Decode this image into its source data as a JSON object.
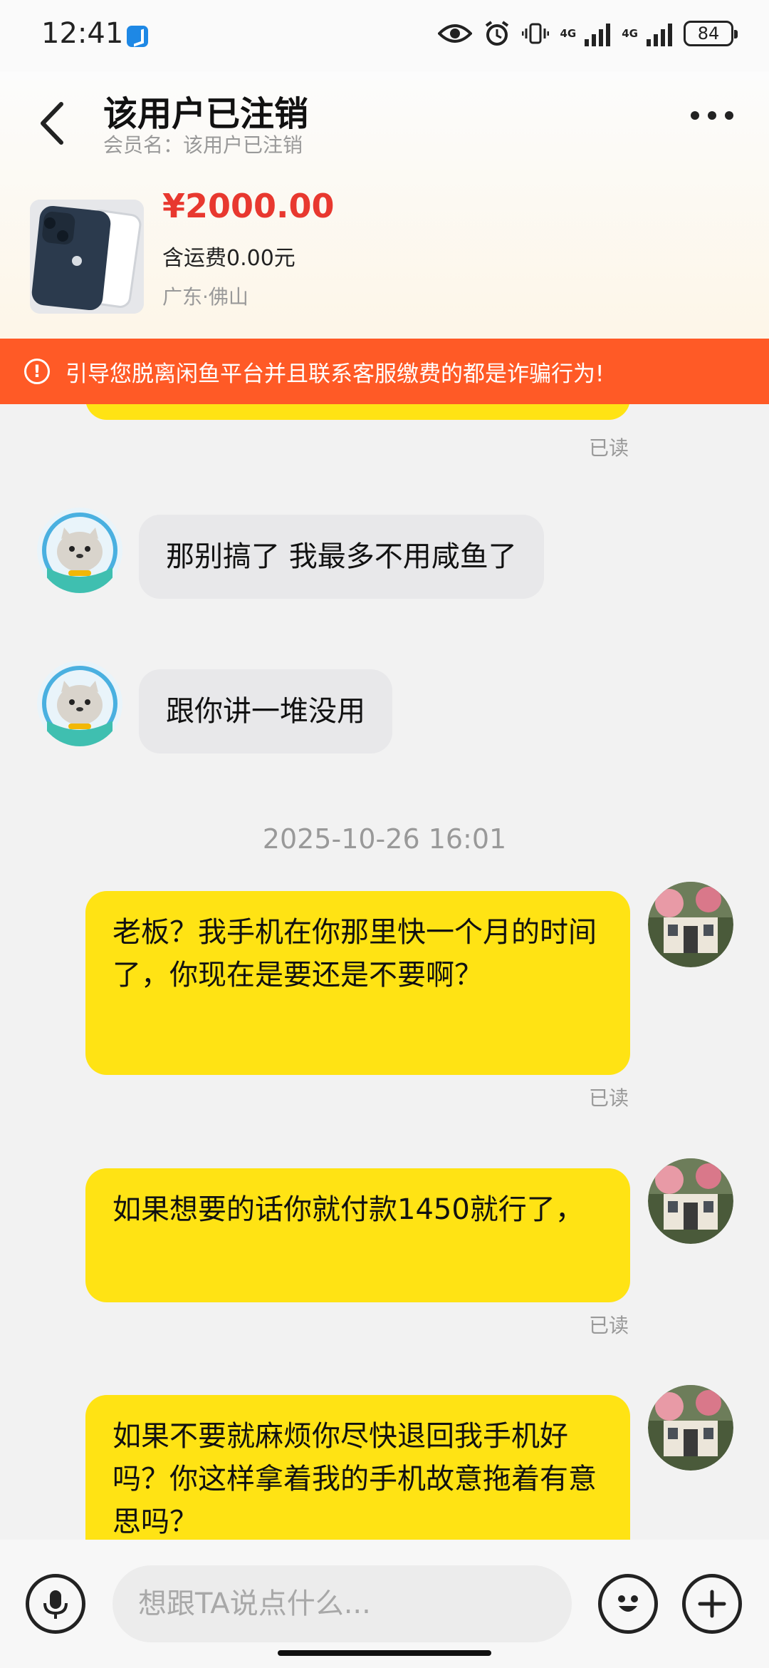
{
  "status_bar": {
    "time": "12:41",
    "network_1": "4G",
    "network_2": "4G",
    "battery": "84"
  },
  "header": {
    "title": "该用户已注销",
    "subtitle": "会员名：该用户已注销"
  },
  "product": {
    "price": "¥2000.00",
    "shipping": "含运费0.00元",
    "location": "广东·佛山"
  },
  "warning": {
    "text": "引导您脱离闲鱼平台并且联系客服缴费的都是诈骗行为!"
  },
  "chat": {
    "read_label": "已读",
    "messages": [
      {
        "text": "那别搞了 我最多不用咸鱼了"
      },
      {
        "text": "跟你讲一堆没用"
      },
      {
        "text": "老板？我手机在你那里快一个月的时间了，你现在是要还是不要啊？"
      },
      {
        "text": "如果想要的话你就付款1450就行了，"
      },
      {
        "text": "如果不要就麻烦你尽快退回我手机好吗？你这样拿着我的手机故意拖着有意思吗？"
      }
    ],
    "timestamp": "2025-10-26 16:01"
  },
  "input_bar": {
    "placeholder": "想跟TA说点什么..."
  },
  "icons": {
    "back": "back-chevron-icon",
    "more": "more-dots-icon",
    "voice": "microphone-icon",
    "emoji": "emoji-icon",
    "plus": "plus-icon"
  },
  "colors": {
    "accent_yellow": "#ffe314",
    "price_red": "#e8382f",
    "warning_orange": "#ff5a26"
  }
}
